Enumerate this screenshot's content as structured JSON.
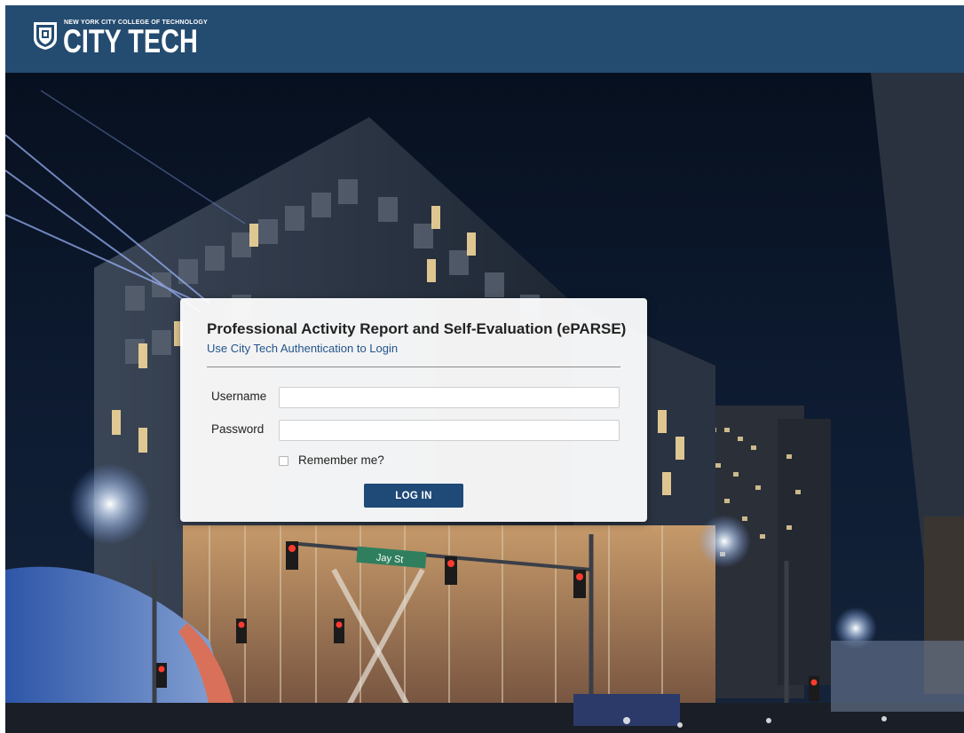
{
  "header": {
    "logo_top_text": "NEW YORK CITY COLLEGE OF TECHNOLOGY",
    "logo_main_text": "CITY TECH",
    "background_color": "#244b70"
  },
  "background": {
    "street_sign_text": "Jay St"
  },
  "login": {
    "title": "Professional Activity Report and Self-Evaluation (ePARSE)",
    "subtitle": "Use City Tech Authentication to Login",
    "username_label": "Username",
    "username_value": "",
    "password_label": "Password",
    "password_value": "",
    "remember_label": "Remember me?",
    "remember_checked": false,
    "submit_label": "LOG IN",
    "accent_color": "#1f4a78"
  }
}
